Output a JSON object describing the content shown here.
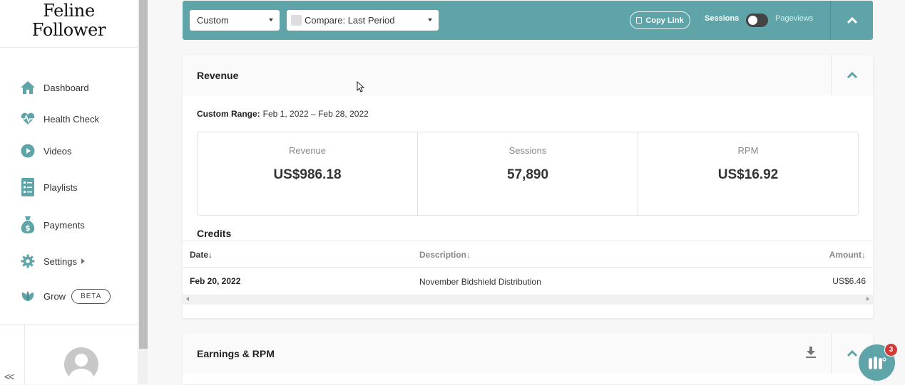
{
  "brand": {
    "line1": "Feline",
    "line2": "Follower"
  },
  "sidebar": {
    "items": [
      {
        "label": "Dashboard",
        "icon": "home-icon"
      },
      {
        "label": "Health Check",
        "icon": "heartbeat-icon"
      },
      {
        "label": "Videos",
        "icon": "play-icon"
      },
      {
        "label": "Playlists",
        "icon": "list-icon"
      },
      {
        "label": "Payments",
        "icon": "money-bag-icon"
      },
      {
        "label": "Settings",
        "icon": "gear-icon"
      },
      {
        "label": "Grow",
        "icon": "leaf-icon",
        "badge": "BETA"
      }
    ],
    "collapse_label": "<<"
  },
  "topbar": {
    "range_select": "Custom",
    "compare_select": "Compare: Last Period",
    "copy_link": "Copy Link",
    "toggle_left": "Sessions",
    "toggle_right": "Pageviews"
  },
  "revenue_card": {
    "title": "Revenue",
    "range_label": "Custom Range:",
    "range_value": "Feb 1, 2022 – Feb 28, 2022",
    "stats": [
      {
        "label": "Revenue",
        "value": "US$986.18"
      },
      {
        "label": "Sessions",
        "value": "57,890"
      },
      {
        "label": "RPM",
        "value": "US$16.92"
      }
    ],
    "credits_title": "Credits",
    "table": {
      "headers": [
        "Date↓",
        "Description↓",
        "Amount↓"
      ],
      "rows": [
        {
          "date": "Feb 20, 2022",
          "description": "November Bidshield Distribution",
          "amount": "US$6.46"
        }
      ]
    }
  },
  "earnings_card": {
    "title": "Earnings & RPM"
  },
  "chat": {
    "badge": "3"
  },
  "colors": {
    "accent": "#5ea4a8",
    "badge": "#d23a3a"
  }
}
